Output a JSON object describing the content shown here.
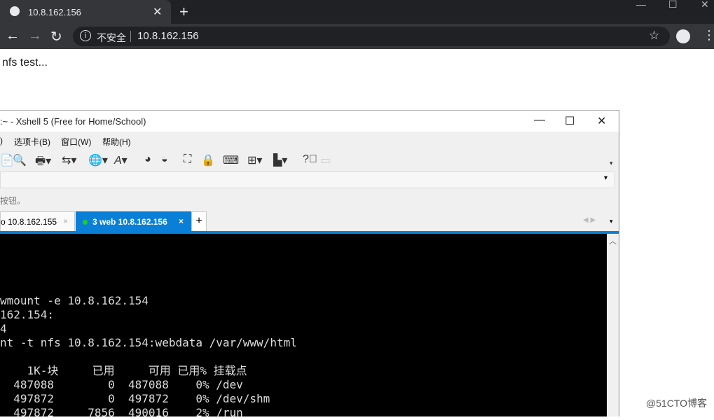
{
  "browser": {
    "tab_title": "10.8.162.156",
    "not_secure": "不安全",
    "url": "10.8.162.156"
  },
  "page": {
    "text": "nfs test..."
  },
  "xshell": {
    "title": ":~ - Xshell 5 (Free for Home/School)",
    "menu": [
      ")",
      "选项卡(B)",
      "窗口(W)",
      "帮助(H)"
    ],
    "hint": "按钮。",
    "tabs": [
      {
        "label": "o 10.8.162.155"
      },
      {
        "label": "3 web 10.8.162.156"
      }
    ],
    "terminal_lines": [
      "wmount -e 10.8.162.154",
      "162.154:",
      "4",
      "nt -t nfs 10.8.162.154:webdata /var/www/html",
      ""
    ],
    "df_header": "    1K-块     已用     可用 已用% 挂载点",
    "df_rows": [
      "  487088        0  487088    0% /dev",
      "  497872        0  497872    0% /dev/shm",
      "  497872     7856  490016    2% /run"
    ]
  },
  "watermark": "@51CTO博客"
}
